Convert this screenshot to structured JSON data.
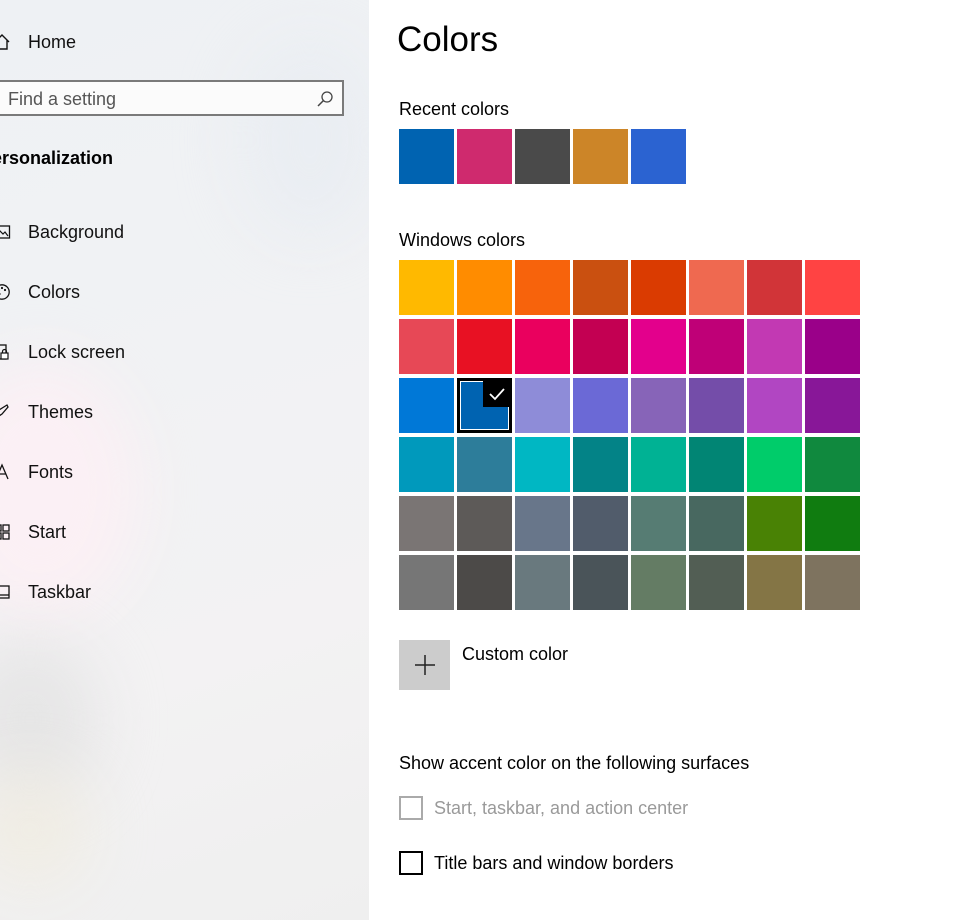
{
  "sidebar": {
    "home_label": "Home",
    "search_placeholder": "Find a setting",
    "section_title": "ersonalization",
    "items": [
      {
        "label": "Background",
        "icon": "image-icon"
      },
      {
        "label": "Colors",
        "icon": "palette-icon"
      },
      {
        "label": "Lock screen",
        "icon": "lock-screen-icon"
      },
      {
        "label": "Themes",
        "icon": "themes-icon"
      },
      {
        "label": "Fonts",
        "icon": "fonts-icon"
      },
      {
        "label": "Start",
        "icon": "start-icon"
      },
      {
        "label": "Taskbar",
        "icon": "taskbar-icon"
      }
    ]
  },
  "main": {
    "title": "Colors",
    "recent_label": "Recent colors",
    "recent_colors": [
      "#0063b1",
      "#cf2a6e",
      "#4a4a4a",
      "#cc8528",
      "#2b63d1"
    ],
    "windows_label": "Windows colors",
    "windows_colors": [
      [
        "#ffb900",
        "#ff8c00",
        "#f7630c",
        "#ca5010",
        "#da3b01",
        "#ef6950",
        "#d13438",
        "#ff4343"
      ],
      [
        "#e74856",
        "#e81123",
        "#ea005e",
        "#c30052",
        "#e3008c",
        "#bf0077",
        "#c239b3",
        "#9a0089"
      ],
      [
        "#0078d7",
        "#0063b1",
        "#8e8cd8",
        "#6b69d6",
        "#8764b8",
        "#744da9",
        "#b146c2",
        "#881798"
      ],
      [
        "#0099bc",
        "#2d7d9a",
        "#00b7c3",
        "#038387",
        "#00b294",
        "#018574",
        "#00cc6a",
        "#10893e"
      ],
      [
        "#7a7574",
        "#5d5a58",
        "#68768a",
        "#515c6b",
        "#567c73",
        "#486860",
        "#498205",
        "#107c10"
      ],
      [
        "#767676",
        "#4c4a48",
        "#69797e",
        "#4a5459",
        "#647c64",
        "#525e54",
        "#847545",
        "#7e735f"
      ]
    ],
    "selected": {
      "row": 2,
      "col": 1
    },
    "custom_label": "Custom color",
    "accent_heading": "Show accent color on the following surfaces",
    "checkbox_start": "Start, taskbar, and action center",
    "checkbox_titlebars": "Title bars and window borders"
  }
}
